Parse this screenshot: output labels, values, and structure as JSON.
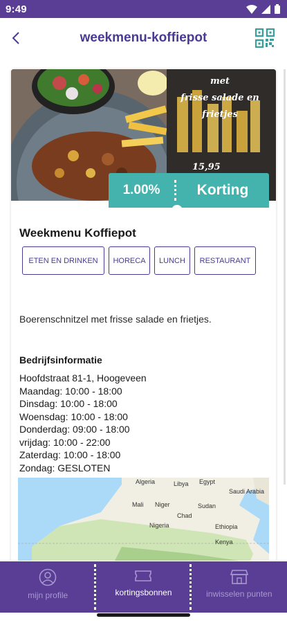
{
  "status_bar": {
    "time": "9:49"
  },
  "app_bar": {
    "title": "weekmenu-koffiepot",
    "back_icon": "chevron-left-icon",
    "qr_icon": "qr-code-icon"
  },
  "hero": {
    "promo_lines": [
      "met",
      "frisse salade en",
      "frietjes"
    ],
    "promo_price": "15,95"
  },
  "discount": {
    "percent": "1.00%",
    "label": "Korting",
    "color": "#45b3ad"
  },
  "details": {
    "title": "Weekmenu Koffiepot",
    "tags": [
      "ETEN EN DRINKEN",
      "HORECA",
      "LUNCH",
      "RESTAURANT"
    ],
    "description": "Boerenschnitzel met frisse salade en frietjes."
  },
  "company_info": {
    "heading": "Bedrijfsinformatie",
    "address": "Hoofdstraat 81-1, Hoogeveen",
    "hours": [
      "Maandag: 10:00 - 18:00",
      "Dinsdag: 10:00 - 18:00",
      "Woensdag: 10:00 - 18:00",
      "Donderdag: 09:00 - 18:00",
      "vrijdag: 10:00 - 22:00",
      "Zaterdag: 10:00 - 18:00",
      "Zondag: GESLOTEN"
    ]
  },
  "map": {
    "labels": [
      "Algeria",
      "Libya",
      "Egypt",
      "Saudi Arabia",
      "Mali",
      "Niger",
      "Sudan",
      "Chad",
      "Nigeria",
      "Ethiopia",
      "Kenya"
    ]
  },
  "bottom_nav": {
    "items": [
      {
        "label": "mijn profile",
        "icon": "user-icon",
        "active": false
      },
      {
        "label": "kortingsbonnen",
        "icon": "ticket-icon",
        "active": true
      },
      {
        "label": "inwisselen punten",
        "icon": "store-icon",
        "active": false
      }
    ]
  },
  "colors": {
    "primary": "#5a3e96",
    "title": "#4a3a93",
    "accent": "#45b3ad"
  }
}
